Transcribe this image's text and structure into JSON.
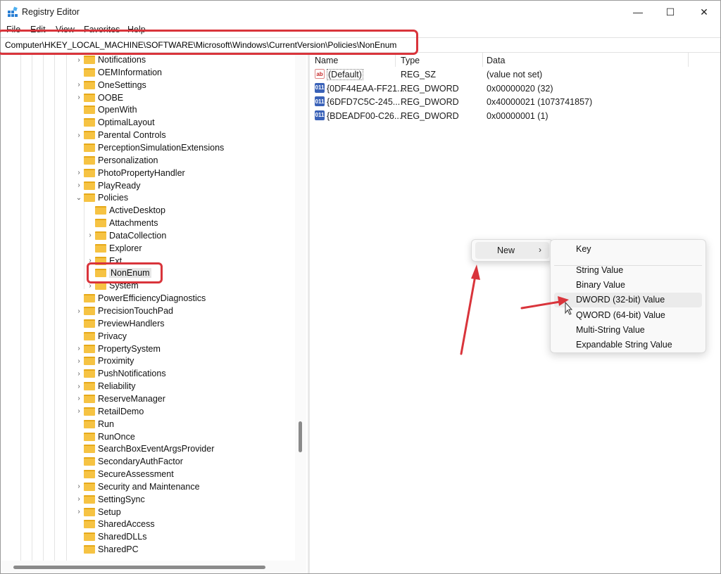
{
  "window": {
    "title": "Registry Editor"
  },
  "window_controls": {
    "minimize": "—",
    "maximize": "☐",
    "close": "✕"
  },
  "menu": [
    "File",
    "Edit",
    "View",
    "Favorites",
    "Help"
  ],
  "address": "Computer\\HKEY_LOCAL_MACHINE\\SOFTWARE\\Microsoft\\Windows\\CurrentVersion\\Policies\\NonEnum",
  "tree": {
    "items": [
      {
        "label": "Notifications",
        "level": 0,
        "chevron": ">"
      },
      {
        "label": "OEMInformation",
        "level": 0,
        "chevron": ""
      },
      {
        "label": "OneSettings",
        "level": 0,
        "chevron": ">"
      },
      {
        "label": "OOBE",
        "level": 0,
        "chevron": ">"
      },
      {
        "label": "OpenWith",
        "level": 0,
        "chevron": ""
      },
      {
        "label": "OptimalLayout",
        "level": 0,
        "chevron": ""
      },
      {
        "label": "Parental Controls",
        "level": 0,
        "chevron": ">"
      },
      {
        "label": "PerceptionSimulationExtensions",
        "level": 0,
        "chevron": ""
      },
      {
        "label": "Personalization",
        "level": 0,
        "chevron": ""
      },
      {
        "label": "PhotoPropertyHandler",
        "level": 0,
        "chevron": ">"
      },
      {
        "label": "PlayReady",
        "level": 0,
        "chevron": ">"
      },
      {
        "label": "Policies",
        "level": 0,
        "chevron": "v"
      },
      {
        "label": "ActiveDesktop",
        "level": 1,
        "chevron": ""
      },
      {
        "label": "Attachments",
        "level": 1,
        "chevron": ""
      },
      {
        "label": "DataCollection",
        "level": 1,
        "chevron": ">"
      },
      {
        "label": "Explorer",
        "level": 1,
        "chevron": ""
      },
      {
        "label": "Ext",
        "level": 1,
        "chevron": ">"
      },
      {
        "label": "NonEnum",
        "level": 1,
        "chevron": "",
        "selected": true
      },
      {
        "label": "System",
        "level": 1,
        "chevron": ">"
      },
      {
        "label": "PowerEfficiencyDiagnostics",
        "level": 0,
        "chevron": ""
      },
      {
        "label": "PrecisionTouchPad",
        "level": 0,
        "chevron": ">"
      },
      {
        "label": "PreviewHandlers",
        "level": 0,
        "chevron": ""
      },
      {
        "label": "Privacy",
        "level": 0,
        "chevron": ""
      },
      {
        "label": "PropertySystem",
        "level": 0,
        "chevron": ">"
      },
      {
        "label": "Proximity",
        "level": 0,
        "chevron": ">"
      },
      {
        "label": "PushNotifications",
        "level": 0,
        "chevron": ">"
      },
      {
        "label": "Reliability",
        "level": 0,
        "chevron": ">"
      },
      {
        "label": "ReserveManager",
        "level": 0,
        "chevron": ">"
      },
      {
        "label": "RetailDemo",
        "level": 0,
        "chevron": ">"
      },
      {
        "label": "Run",
        "level": 0,
        "chevron": ""
      },
      {
        "label": "RunOnce",
        "level": 0,
        "chevron": ""
      },
      {
        "label": "SearchBoxEventArgsProvider",
        "level": 0,
        "chevron": ""
      },
      {
        "label": "SecondaryAuthFactor",
        "level": 0,
        "chevron": ""
      },
      {
        "label": "SecureAssessment",
        "level": 0,
        "chevron": ""
      },
      {
        "label": "Security and Maintenance",
        "level": 0,
        "chevron": ">"
      },
      {
        "label": "SettingSync",
        "level": 0,
        "chevron": ">"
      },
      {
        "label": "Setup",
        "level": 0,
        "chevron": ">"
      },
      {
        "label": "SharedAccess",
        "level": 0,
        "chevron": ""
      },
      {
        "label": "SharedDLLs",
        "level": 0,
        "chevron": ""
      },
      {
        "label": "SharedPC",
        "level": 0,
        "chevron": ""
      }
    ]
  },
  "values": {
    "headers": [
      "Name",
      "Type",
      "Data"
    ],
    "rows": [
      {
        "icon": "string-value-icon",
        "icon_text": "ab",
        "name": "(Default)",
        "type": "REG_SZ",
        "data": "(value not set)"
      },
      {
        "icon": "binary-value-icon",
        "icon_text": "011",
        "name": "{0DF44EAA-FF21...",
        "type": "REG_DWORD",
        "data": "0x00000020 (32)"
      },
      {
        "icon": "binary-value-icon",
        "icon_text": "011",
        "name": "{6DFD7C5C-245...",
        "type": "REG_DWORD",
        "data": "0x40000021 (1073741857)"
      },
      {
        "icon": "binary-value-icon",
        "icon_text": "011",
        "name": "{BDEADF00-C26...",
        "type": "REG_DWORD",
        "data": "0x00000001 (1)"
      }
    ]
  },
  "context_menu": {
    "new_label": "New",
    "arrow": "›"
  },
  "submenu": {
    "key": "Key",
    "items": [
      "String Value",
      "Binary Value",
      "DWORD (32-bit) Value",
      "QWORD (64-bit) Value",
      "Multi-String Value",
      "Expandable String Value"
    ],
    "hovered": "DWORD (32-bit) Value"
  },
  "colors": {
    "highlight": "#d9343b",
    "folder": "#f6c343"
  }
}
